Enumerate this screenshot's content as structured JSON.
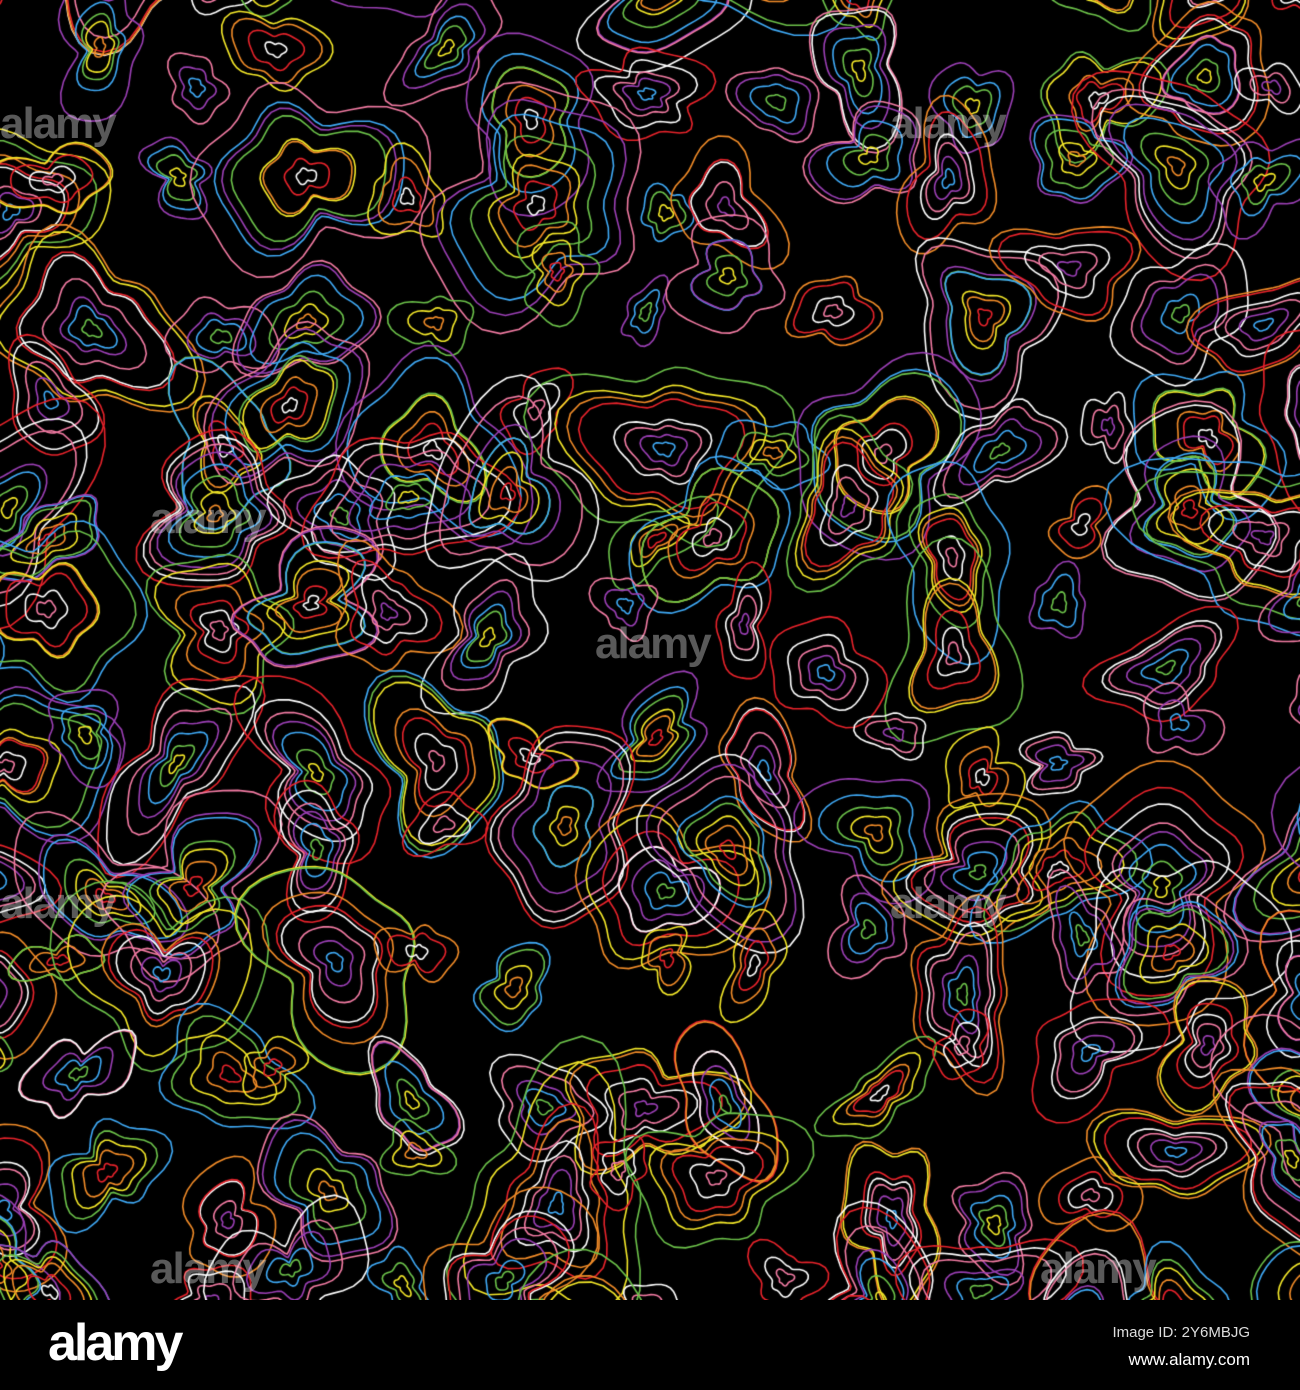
{
  "image": {
    "subject": "topographic contour line pattern",
    "background_color": "#000000",
    "line_palette": [
      "#e8232b",
      "#f28c28",
      "#f4e829",
      "#6cc24a",
      "#3fa9f5",
      "#9b3fb5",
      "#f27ba3",
      "#ffffff"
    ]
  },
  "watermark": {
    "text": "alamy"
  },
  "footer": {
    "logo": "alamy",
    "image_id": "Image ID: 2Y6MBJG",
    "site": "www.alamy.com"
  }
}
